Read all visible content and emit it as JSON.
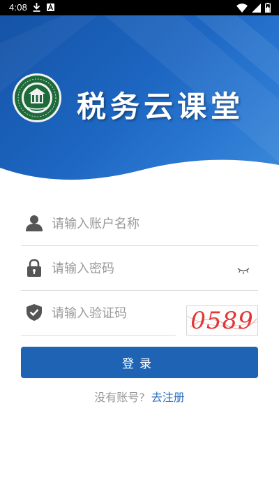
{
  "status_bar": {
    "time": "4:08",
    "left_icons": [
      "download-icon",
      "a-notification-icon"
    ],
    "right_icons": [
      "wifi-icon",
      "signal-icon",
      "battery-icon"
    ]
  },
  "header": {
    "title": "税务云课堂"
  },
  "form": {
    "username": {
      "placeholder": "请输入账户名称",
      "value": "",
      "icon": "user-icon"
    },
    "password": {
      "placeholder": "请输入密码",
      "value": "",
      "icon": "lock-icon",
      "toggle_icon": "eye-closed-icon"
    },
    "captcha": {
      "placeholder": "请输入验证码",
      "value": "",
      "icon": "shield-icon",
      "image_text": "0589"
    },
    "login_label": "登录"
  },
  "footer": {
    "prompt": "没有账号?",
    "register_label": "去注册"
  },
  "colors": {
    "primary": "#1e63b4",
    "link": "#2f73c4",
    "placeholder": "#9a9a9a",
    "captcha": "#e03636"
  }
}
